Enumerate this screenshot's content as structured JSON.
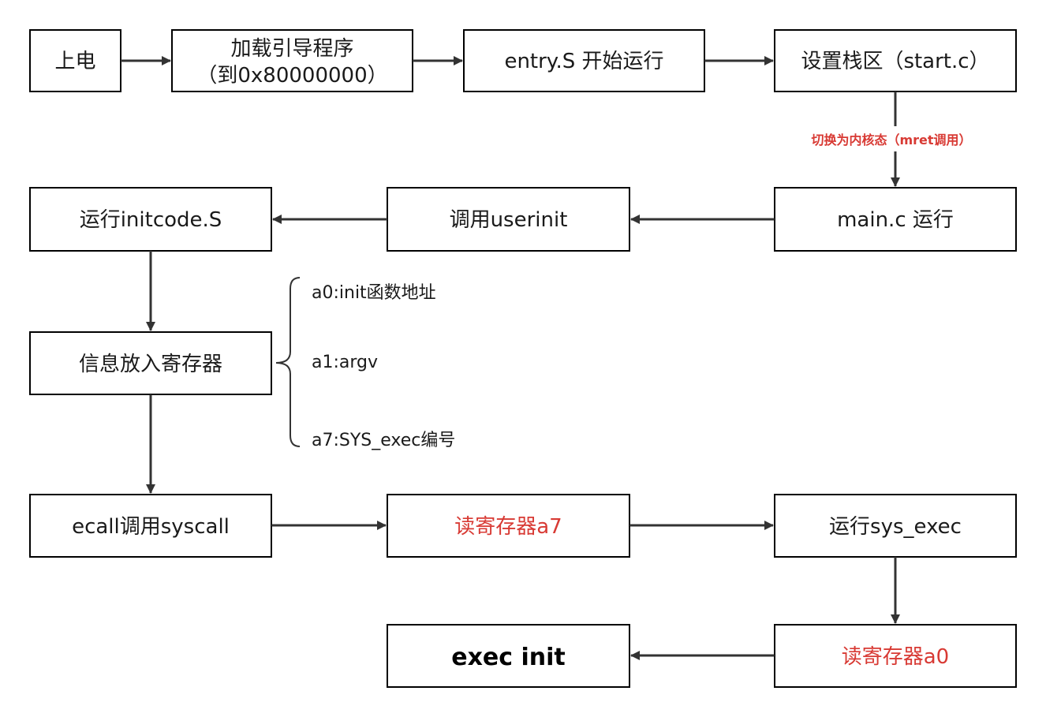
{
  "nodes": {
    "power_on": {
      "lines": [
        "上电"
      ]
    },
    "load_bootloader": {
      "lines": [
        "加载引导程序",
        "（到0x80000000）"
      ]
    },
    "entry_start": {
      "lines": [
        "entry.S 开始运行"
      ]
    },
    "set_stack": {
      "lines": [
        "设置栈区（start.c）"
      ]
    },
    "main_run": {
      "lines": [
        "main.c 运行"
      ]
    },
    "call_userinit": {
      "lines": [
        "调用userinit"
      ]
    },
    "run_initcode": {
      "lines": [
        "运行initcode.S"
      ]
    },
    "regs_store": {
      "lines": [
        "信息放入寄存器"
      ]
    },
    "ecall": {
      "lines": [
        "ecall调用syscall"
      ]
    },
    "read_a7": {
      "lines": [
        "读寄存器a7"
      ]
    },
    "run_sys_exec": {
      "lines": [
        "运行sys_exec"
      ]
    },
    "read_a0": {
      "lines": [
        "读寄存器a0"
      ]
    },
    "exec_init": {
      "lines": [
        "exec init"
      ]
    }
  },
  "edge_labels": {
    "to_kernel_mode": "切换为内核态（mret调用）"
  },
  "notes": {
    "a0": "a0:init函数地址",
    "a1": "a1:argv",
    "a7": "a7:SYS_exec编号"
  },
  "colors": {
    "accent_red": "#d83a34",
    "border": "#000000",
    "arrow": "#333333"
  }
}
